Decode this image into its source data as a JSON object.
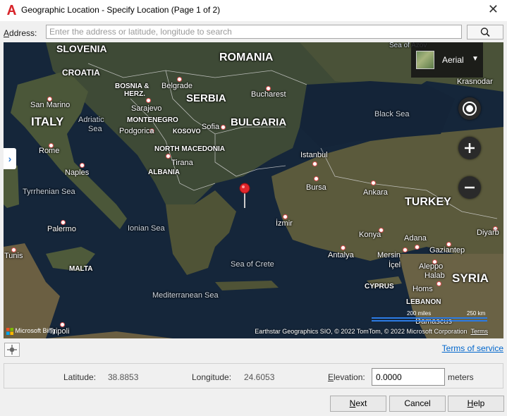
{
  "window": {
    "title": "Geographic Location - Specify Location (Page 1 of 2)"
  },
  "address": {
    "label_prefix": "A",
    "label_rest": "ddress:",
    "placeholder": "Enter the address or latitude, longitude to search",
    "value": ""
  },
  "map": {
    "style_label": "Aerial",
    "attribution": "Earthstar Geographics SIO, © 2022 TomTom, © 2022 Microsoft Corporation",
    "terms_link": "Terms",
    "bing_logo": "Microsoft Bing",
    "scale": {
      "miles": "200 miles",
      "km": "250 km"
    },
    "countries": [
      "SLOVENIA",
      "CROATIA",
      "ROMANIA",
      "SERBIA",
      "BULGARIA",
      "ITALY",
      "TURKEY",
      "SYRIA"
    ],
    "small_countries": [
      "BOSNIA &",
      "HERZ.",
      "MONTENEGRO",
      "KOSOVO",
      "NORTH MACEDONIA",
      "ALBANIA",
      "MALTA",
      "CYPRUS",
      "LEBANON"
    ],
    "cities": [
      "Belgrade",
      "Bucharest",
      "Krasnodar",
      "San Marino",
      "Sarajevo",
      "Podgorica",
      "Sofia",
      "Rome",
      "Tirana",
      "Istanbul",
      "Naples",
      "Bursa",
      "Ankara",
      "İzmir",
      "Palermo",
      "Konya",
      "Adana",
      "Diyarb",
      "Tunis",
      "Antalya",
      "Mersin",
      "İçel",
      "Gaziantep",
      "Aleppo",
      "Halab",
      "Homs",
      "Damascus",
      "Tripoli"
    ],
    "seas": [
      "Sea of Azov",
      "Black Sea",
      "Adriatic",
      "Sea",
      "Tyrrhenian Sea",
      "Ionian Sea",
      "Sea of Crete",
      "Mediterranean Sea"
    ]
  },
  "links": {
    "terms_of_service": "Terms of service"
  },
  "coords": {
    "latitude_label": "Latitude:",
    "latitude": "38.8853",
    "longitude_label": "Longitude:",
    "longitude": "24.6053",
    "elevation_prefix": "E",
    "elevation_rest": "levation:",
    "elevation": "0.0000",
    "elevation_unit": "meters"
  },
  "buttons": {
    "next_prefix": "N",
    "next_rest": "ext",
    "cancel": "Cancel",
    "help_prefix": "H",
    "help_rest": "elp"
  }
}
